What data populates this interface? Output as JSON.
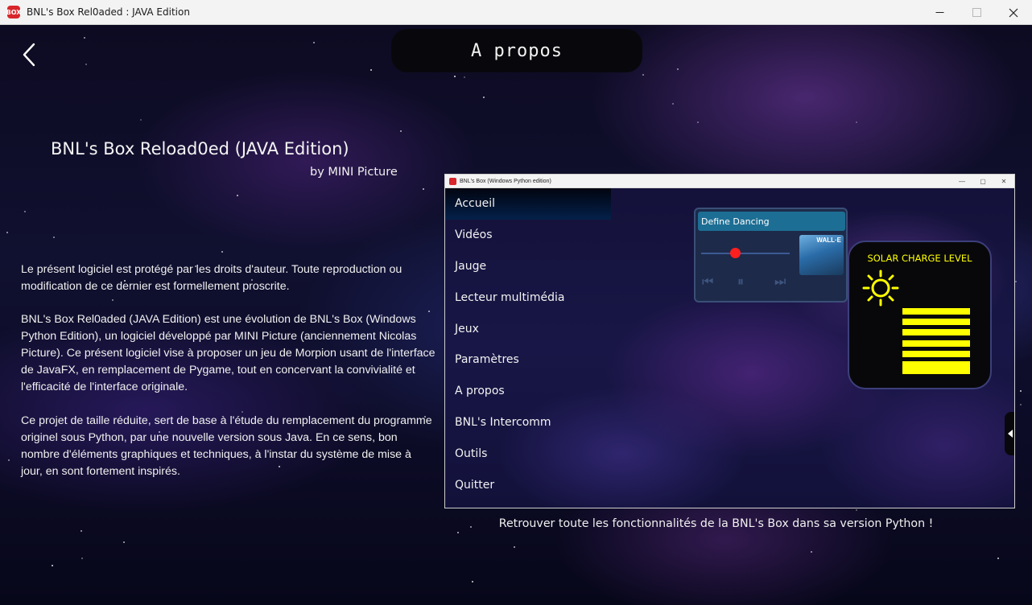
{
  "window": {
    "title": "BNL's Box Rel0aded : JAVA Edition",
    "icon_text": "BOX"
  },
  "header": {
    "title": "A propos"
  },
  "about": {
    "product_title": "BNL's Box Reload0ed (JAVA Edition)",
    "byline": "by MINI Picture",
    "paragraphs": [
      "Le présent logiciel est protégé par les droits d'auteur. Toute reproduction ou modification de ce dernier est formellement proscrite.",
      "BNL's Box Rel0aded (JAVA Edition) est une évolution de BNL's Box (Windows Python Edition), un logiciel développé par MINI Picture (anciennement Nicolas Picture). Ce présent logiciel vise à proposer un jeu de Morpion usant de l'interface de JavaFX, en remplacement de Pygame, tout en concervant la convivialité et l'efficacité de l'interface originale.",
      "Ce projet de taille réduite, sert de base à l'étude du remplacement du programme originel sous Python, par une nouvelle version sous Java. En ce sens, bon nombre d'éléments graphiques et techniques, à l'instar du système de mise à jour, en sont fortement inspirés."
    ]
  },
  "preview": {
    "window_title": "BNL's Box (Windows Python edition)",
    "menu": [
      "Accueil",
      "Vidéos",
      "Jauge",
      "Lecteur multimédia",
      "Jeux",
      "Paramètres",
      "A propos",
      "BNL's Intercomm",
      "Outils",
      "Quitter"
    ],
    "active_menu_index": 0,
    "player": {
      "track": "Define Dancing",
      "cover_label": "WALL·E",
      "progress": 0.39
    },
    "solar": {
      "title": "SOLAR CHARGE LEVEL",
      "bars_lit": 6
    }
  },
  "caption": "Retrouver toute les fonctionnalités de la BNL's Box dans sa version Python !",
  "colors": {
    "accent_yellow": "#ffff00",
    "knob_red": "#ff1f1f",
    "track_blue": "#1d6e94"
  }
}
